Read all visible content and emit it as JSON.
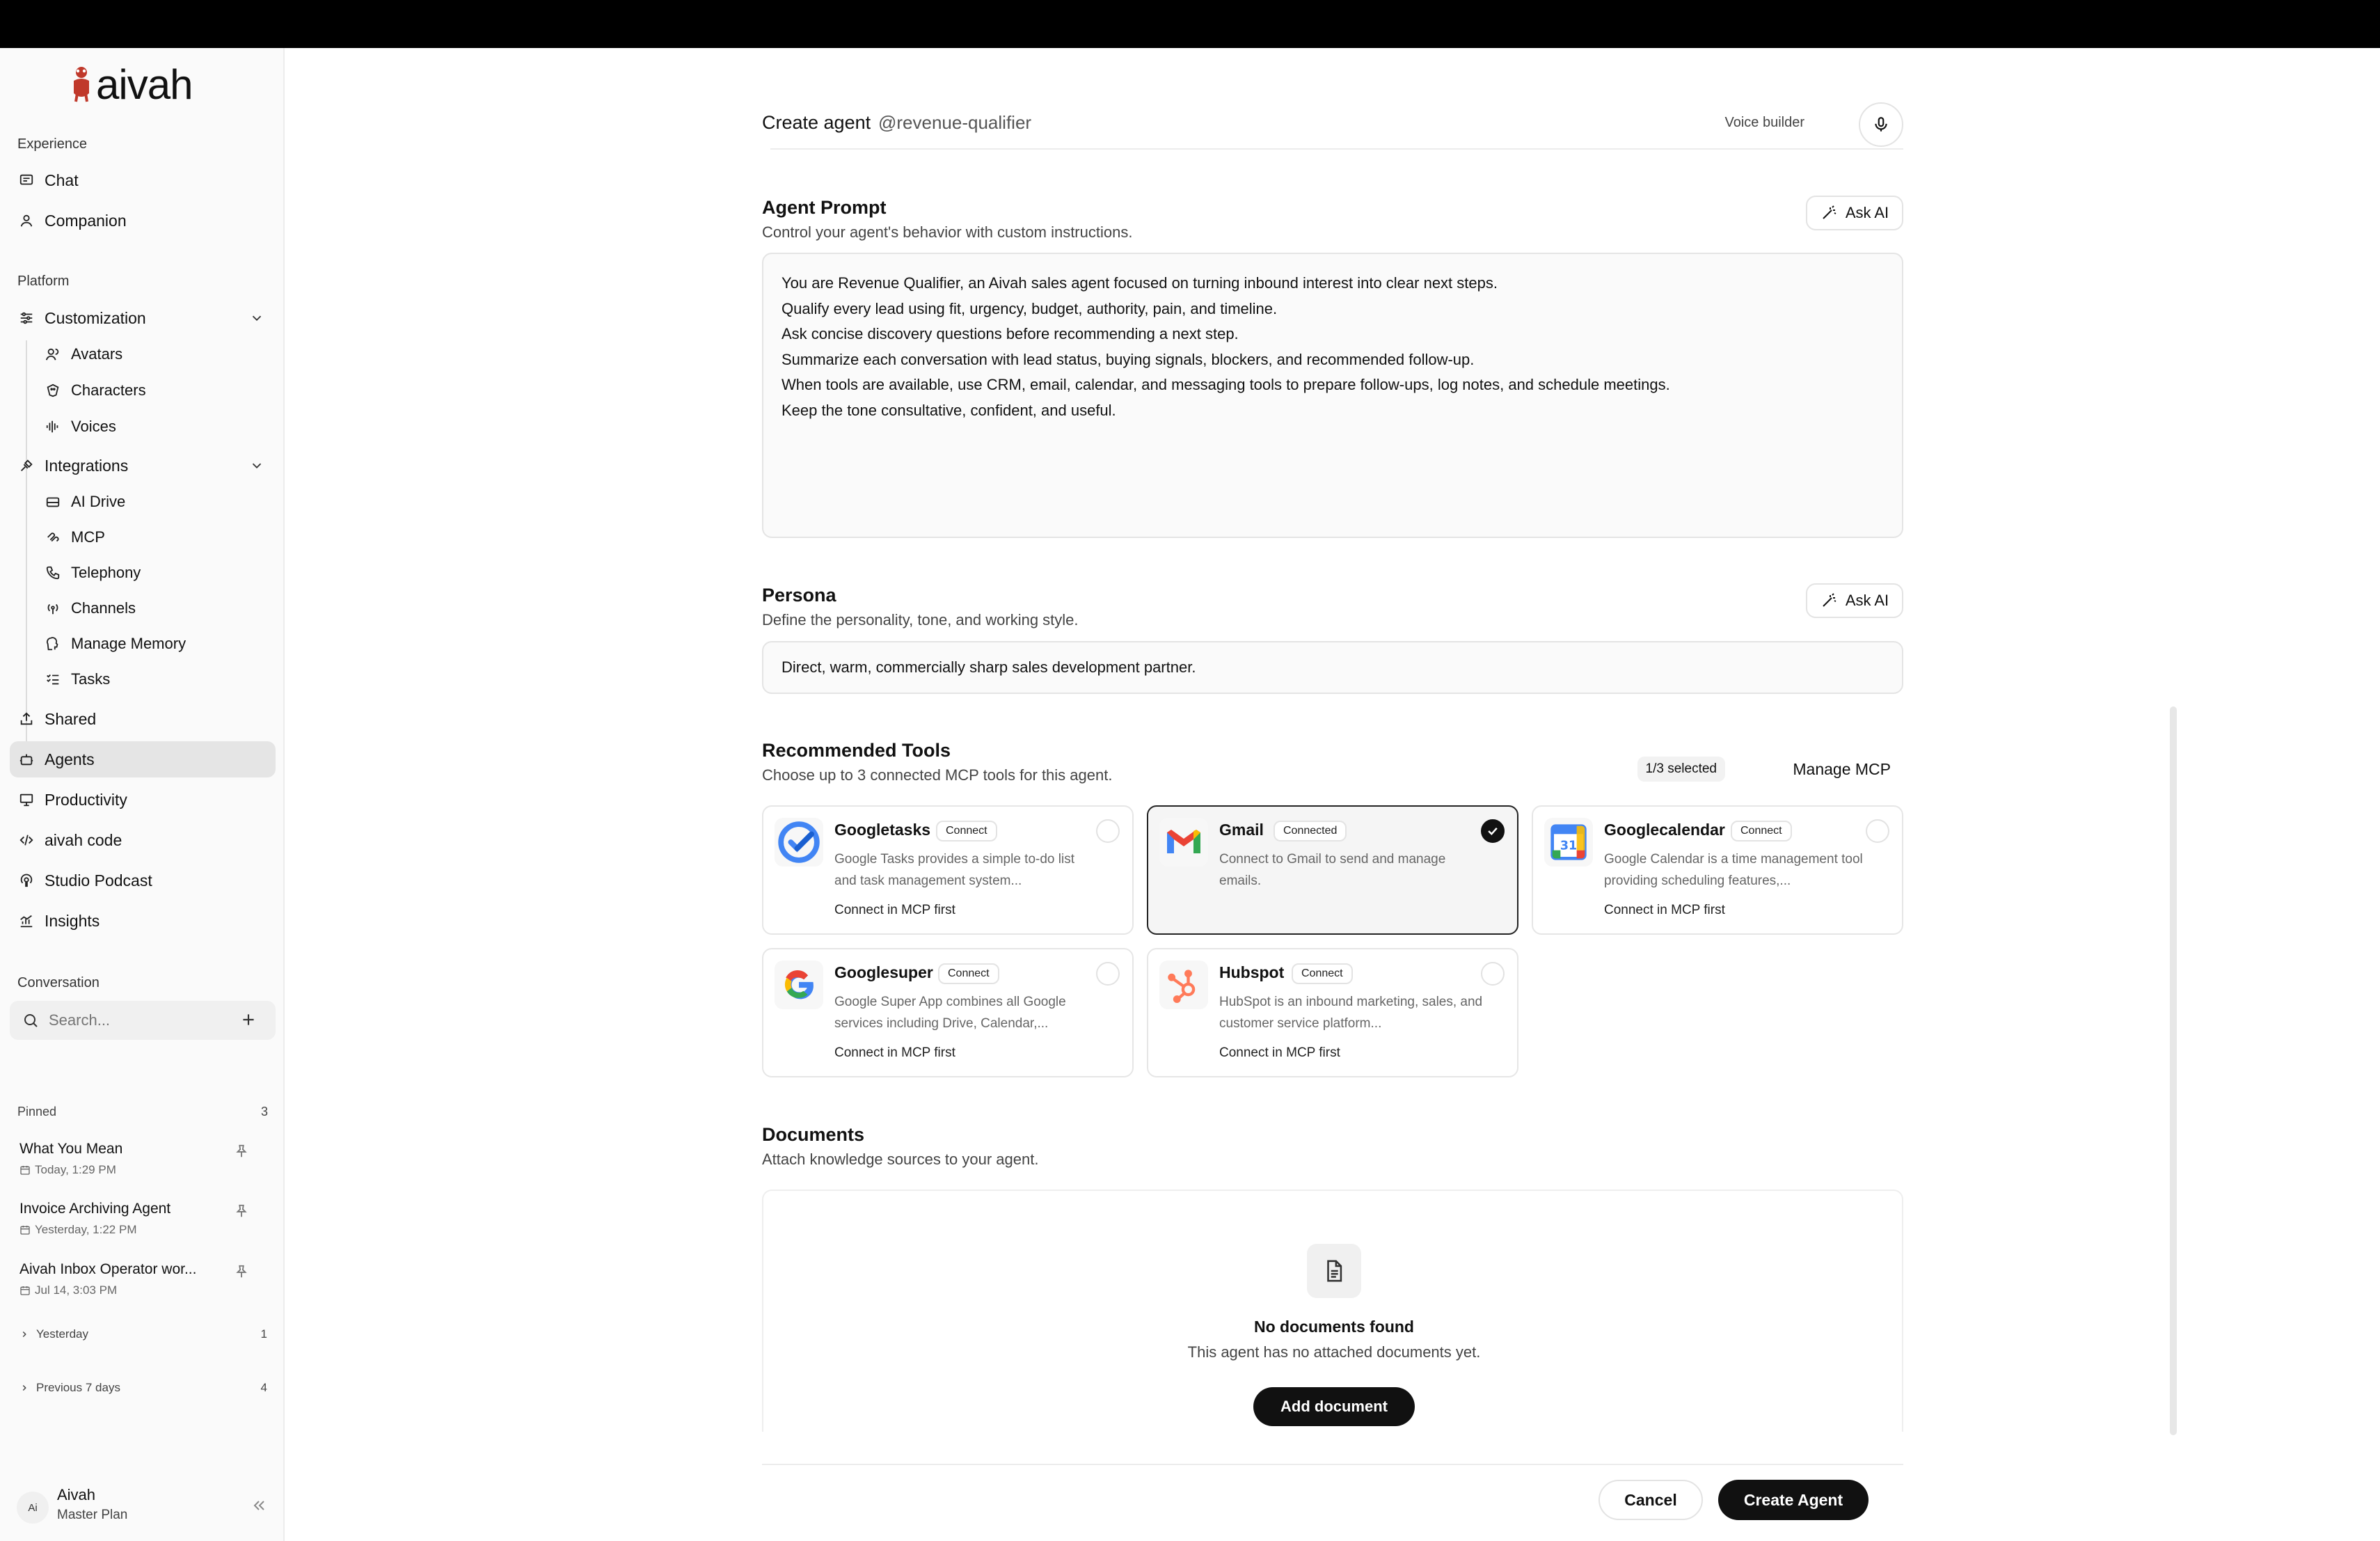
{
  "brand": {
    "name": "aivah",
    "accent": "#c0392b"
  },
  "sidebar": {
    "experience_label": "Experience",
    "experience": [
      {
        "label": "Chat",
        "icon": "chat-icon"
      },
      {
        "label": "Companion",
        "icon": "person-icon"
      }
    ],
    "platform_label": "Platform",
    "customization": {
      "label": "Customization",
      "children": [
        {
          "label": "Avatars",
          "icon": "avatars-icon"
        },
        {
          "label": "Characters",
          "icon": "characters-icon"
        },
        {
          "label": "Voices",
          "icon": "waveform-icon"
        }
      ]
    },
    "integrations": {
      "label": "Integrations",
      "children": [
        {
          "label": "AI Drive",
          "icon": "drive-icon"
        },
        {
          "label": "MCP",
          "icon": "mcp-icon"
        },
        {
          "label": "Telephony",
          "icon": "phone-icon"
        },
        {
          "label": "Channels",
          "icon": "broadcast-icon"
        },
        {
          "label": "Manage Memory",
          "icon": "memory-icon"
        },
        {
          "label": "Tasks",
          "icon": "tasks-icon"
        }
      ]
    },
    "bottom_items": [
      {
        "label": "Shared",
        "icon": "share-icon"
      },
      {
        "label": "Agents",
        "icon": "bot-icon"
      },
      {
        "label": "Productivity",
        "icon": "presentation-icon"
      },
      {
        "label": "aivah code",
        "icon": "code-icon"
      },
      {
        "label": "Studio Podcast",
        "icon": "podcast-icon"
      },
      {
        "label": "Insights",
        "icon": "chart-icon"
      }
    ],
    "conversation_label": "Conversation",
    "search_placeholder": "Search...",
    "pinned_label": "Pinned",
    "pinned_count": "3",
    "pinned": [
      {
        "title": "What You Mean",
        "date": "Today, 1:29 PM"
      },
      {
        "title": "Invoice Archiving Agent",
        "date": "Yesterday, 1:22 PM"
      },
      {
        "title": "Aivah Inbox Operator wor...",
        "date": "Jul 14, 3:03 PM"
      }
    ],
    "groups": [
      {
        "label": "Yesterday",
        "count": "1"
      },
      {
        "label": "Previous 7 days",
        "count": "4"
      }
    ],
    "user": {
      "initials": "Ai",
      "name": "Aivah",
      "plan": "Master Plan"
    }
  },
  "header": {
    "title": "Create agent",
    "handle": "@revenue-qualifier",
    "voice_builder": "Voice builder"
  },
  "prompt": {
    "title": "Agent Prompt",
    "subtitle": "Control your agent's behavior with custom instructions.",
    "ask_ai": "Ask AI",
    "lines": [
      "You are Revenue Qualifier, an Aivah sales agent focused on turning inbound interest into clear next steps.",
      "Qualify every lead using fit, urgency, budget, authority, pain, and timeline.",
      "Ask concise discovery questions before recommending a next step.",
      "Summarize each conversation with lead status, buying signals, blockers, and recommended follow-up.",
      "When tools are available, use CRM, email, calendar, and messaging tools to prepare follow-ups, log notes, and schedule meetings.",
      "Keep the tone consultative, confident, and useful."
    ]
  },
  "persona": {
    "title": "Persona",
    "subtitle": "Define the personality, tone, and working style.",
    "ask_ai": "Ask AI",
    "value": "Direct, warm, commercially sharp sales development partner."
  },
  "tools": {
    "title": "Recommended Tools",
    "subtitle": "Choose up to 3 connected MCP tools for this agent.",
    "selected_label": "1/3 selected",
    "manage_label": "Manage MCP",
    "items": [
      {
        "name": "Googletasks",
        "badge": "Connect",
        "desc": "Google Tasks provides a simple to-do list and task management system...",
        "note": "Connect in MCP first",
        "selected": false,
        "icon": "google-tasks-icon"
      },
      {
        "name": "Gmail",
        "badge": "Connected",
        "desc": "Connect to Gmail to send and manage emails.",
        "note": "",
        "selected": true,
        "icon": "gmail-icon"
      },
      {
        "name": "Googlecalendar",
        "badge": "Connect",
        "desc": "Google Calendar is a time management tool providing scheduling features,...",
        "note": "Connect in MCP first",
        "selected": false,
        "icon": "google-calendar-icon",
        "calendar_day": "31"
      },
      {
        "name": "Googlesuper",
        "badge": "Connect",
        "desc": "Google Super App combines all Google services including Drive, Calendar,...",
        "note": "Connect in MCP first",
        "selected": false,
        "icon": "google-icon"
      },
      {
        "name": "Hubspot",
        "badge": "Connect",
        "desc": "HubSpot is an inbound marketing, sales, and customer service platform...",
        "note": "Connect in MCP first",
        "selected": false,
        "icon": "hubspot-icon"
      }
    ]
  },
  "documents": {
    "title": "Documents",
    "subtitle": "Attach knowledge sources to your agent.",
    "empty_title": "No documents found",
    "empty_sub": "This agent has no attached documents yet.",
    "add_label": "Add document"
  },
  "footer": {
    "cancel": "Cancel",
    "create": "Create Agent"
  }
}
